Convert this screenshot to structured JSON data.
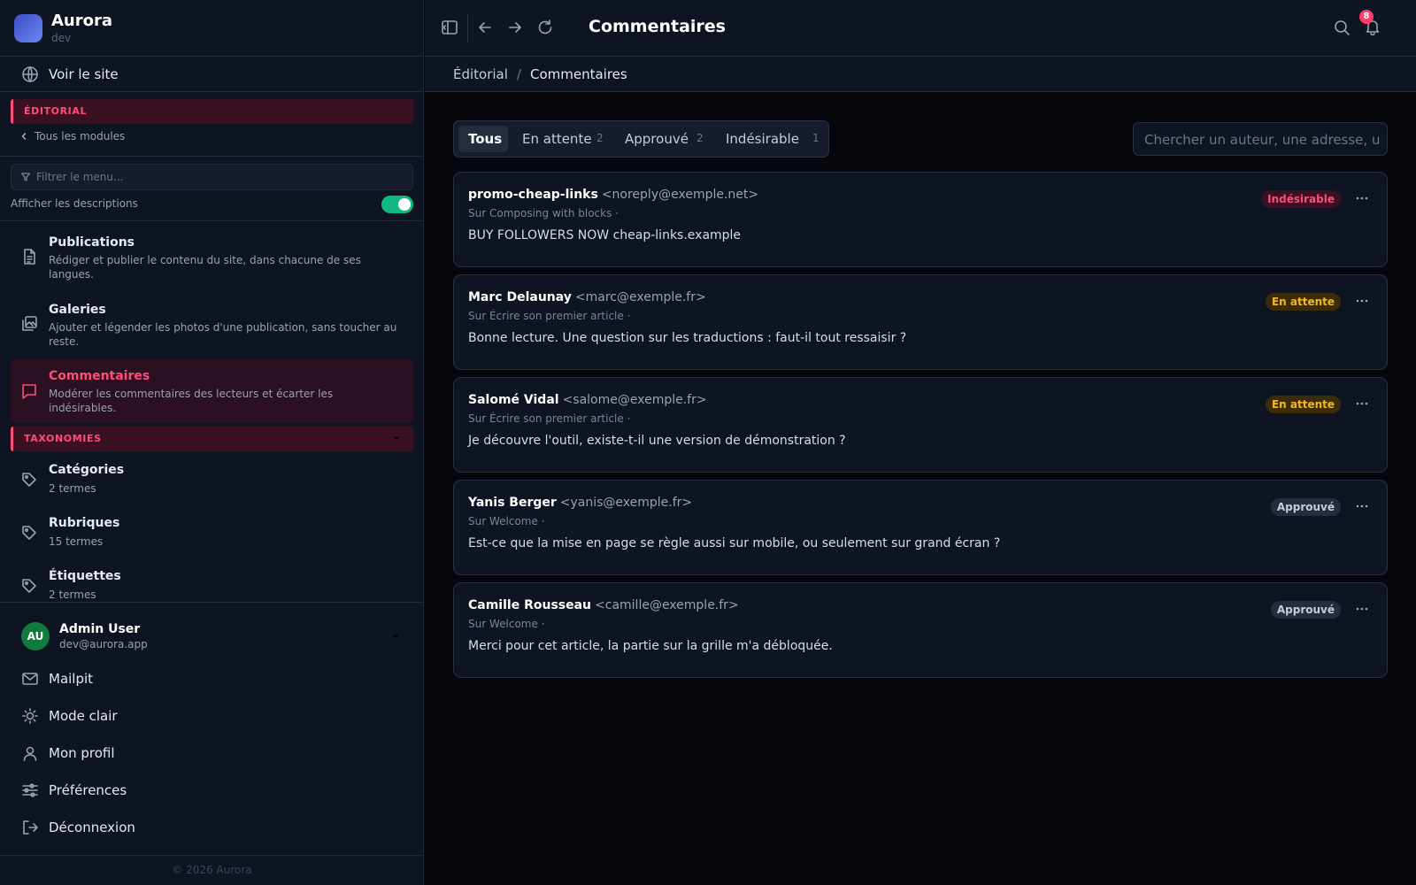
{
  "app": {
    "name": "Aurora",
    "env": "dev"
  },
  "sidebar": {
    "view_site": "Voir le site",
    "section_editorial": "ÉDITORIAL",
    "back_link": "Tous les modules",
    "filter_placeholder": "Filtrer le menu...",
    "show_descriptions_label": "Afficher les descriptions",
    "show_descriptions": true,
    "items": [
      {
        "title": "Publications",
        "desc": "Rédiger et publier le contenu du site, dans chacune de ses langues.",
        "icon": "document-icon"
      },
      {
        "title": "Galeries",
        "desc": "Ajouter et légender les photos d'une publication, sans toucher au reste.",
        "icon": "gallery-icon"
      },
      {
        "title": "Commentaires",
        "desc": "Modérer les commentaires des lecteurs et écarter les indésirables.",
        "icon": "comment-icon",
        "active": true
      }
    ],
    "section_taxonomies": "TAXONOMIES",
    "taxonomies": [
      {
        "title": "Catégories",
        "desc": "2 termes"
      },
      {
        "title": "Rubriques",
        "desc": "15 termes"
      },
      {
        "title": "Étiquettes",
        "desc": "2 termes"
      }
    ],
    "user": {
      "initials": "AU",
      "name": "Admin User",
      "email": "dev@aurora.app"
    },
    "bottom": [
      {
        "label": "Mailpit",
        "icon": "mail-icon"
      },
      {
        "label": "Mode clair",
        "icon": "sun-icon"
      },
      {
        "label": "Mon profil",
        "icon": "user-icon"
      },
      {
        "label": "Préférences",
        "icon": "sliders-icon"
      },
      {
        "label": "Déconnexion",
        "icon": "logout-icon"
      }
    ],
    "footer": "© 2026 Aurora"
  },
  "topbar": {
    "title": "Commentaires",
    "notifications": "8"
  },
  "breadcrumb": {
    "parent": "Éditorial",
    "separator": "/",
    "current": "Commentaires"
  },
  "tabs": [
    {
      "label": "Tous",
      "count": "",
      "active": true
    },
    {
      "label": "En attente",
      "count": "2"
    },
    {
      "label": "Approuvé",
      "count": "2"
    },
    {
      "label": "Indésirable",
      "count": "1"
    }
  ],
  "search": {
    "placeholder": "Chercher un auteur, une adresse, un texte..."
  },
  "comments": [
    {
      "author": "promo-cheap-links",
      "email": "<noreply@exemple.net>",
      "meta": "Sur Composing with blocks ·",
      "body": "BUY FOLLOWERS NOW cheap-links.example",
      "status": "Indésirable",
      "status_kind": "spam"
    },
    {
      "author": "Marc Delaunay",
      "email": "<marc@exemple.fr>",
      "meta": "Sur Écrire son premier article ·",
      "body": "Bonne lecture. Une question sur les traductions : faut-il tout ressaisir ?",
      "status": "En attente",
      "status_kind": "pending"
    },
    {
      "author": "Salomé Vidal",
      "email": "<salome@exemple.fr>",
      "meta": "Sur Écrire son premier article ·",
      "body": "Je découvre l'outil, existe-t-il une version de démonstration ?",
      "status": "En attente",
      "status_kind": "pending"
    },
    {
      "author": "Yanis Berger",
      "email": "<yanis@exemple.fr>",
      "meta": "Sur Welcome ·",
      "body": "Est-ce que la mise en page se règle aussi sur mobile, ou seulement sur grand écran ?",
      "status": "Approuvé",
      "status_kind": "approved"
    },
    {
      "author": "Camille Rousseau",
      "email": "<camille@exemple.fr>",
      "meta": "Sur Welcome ·",
      "body": "Merci pour cet article, la partie sur la grille m'a débloquée.",
      "status": "Approuvé",
      "status_kind": "approved"
    }
  ],
  "colors": {
    "accent": "#ff4d79",
    "pending": "#f5b71f",
    "toggle": "#10b981",
    "background": "#05070d",
    "panel": "#0f1422"
  }
}
